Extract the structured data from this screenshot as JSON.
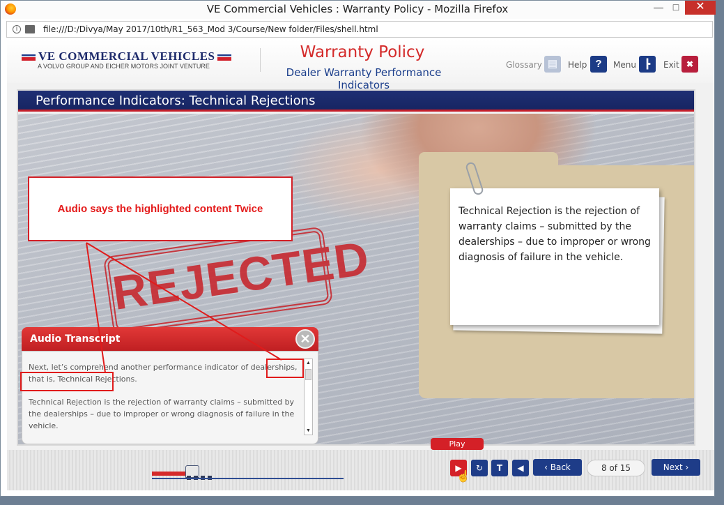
{
  "browser": {
    "window_title": "VE Commercial Vehicles : Warranty Policy - Mozilla Firefox",
    "url": "file:///D:/Divya/May 2017/10th/R1_563_Mod 3/Course/New folder/Files/shell.html",
    "controls": {
      "minimize": "—",
      "maximize": "□",
      "close": "✕"
    }
  },
  "header": {
    "brand": "VE COMMERCIAL VEHICLES",
    "brand_tagline": "A VOLVO GROUP AND EICHER MOTORS JOINT VENTURE",
    "course_title": "Warranty Policy",
    "course_subtitle": "Dealer Warranty Performance Indicators",
    "glossary_label": "Glossary",
    "help_label": "Help",
    "help_icon": "?",
    "menu_label": "Menu",
    "exit_label": "Exit",
    "exit_icon": "✖"
  },
  "slide": {
    "title": "Performance Indicators: Technical Rejections",
    "stamp": "REJECTED",
    "callout": "Audio says the highlighted content Twice",
    "card_text": "Technical Rejection is the rejection of warranty claims  – submitted by the dealerships  – due to improper or wrong diagnosis of failure in the vehicle."
  },
  "transcript": {
    "title": "Audio Transcript",
    "close": "✕",
    "paragraph1": "Next, let’s comprehend another performance indicator of dealerships, that is, Technical Rejections.",
    "paragraph2": "Technical Rejection is the rejection of warranty claims – submitted by the dealerships  –  due to improper or wrong diagnosis of failure in the vehicle."
  },
  "footer": {
    "play_tooltip": "Play",
    "play_icon": "▶",
    "replay_icon": "↻",
    "text_icon": "T",
    "audio_icon": "◀",
    "back_label": "‹ Back",
    "page_counter": "8 of 15",
    "next_label": "Next ›"
  },
  "colors": {
    "brand_blue": "#1e3c88",
    "accent_red": "#d42027"
  }
}
